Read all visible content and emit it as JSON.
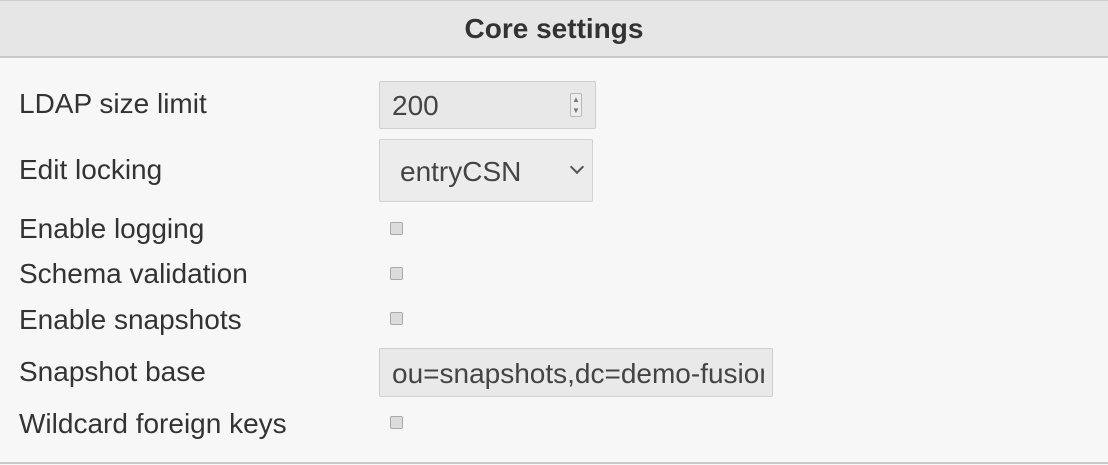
{
  "panel": {
    "title": "Core settings"
  },
  "fields": {
    "ldap_size_limit": {
      "label": "LDAP size limit",
      "value": "200"
    },
    "edit_locking": {
      "label": "Edit locking",
      "value": "entryCSN"
    },
    "enable_logging": {
      "label": "Enable logging",
      "checked": false
    },
    "schema_validation": {
      "label": "Schema validation",
      "checked": false
    },
    "enable_snapshots": {
      "label": "Enable snapshots",
      "checked": false
    },
    "snapshot_base": {
      "label": "Snapshot base",
      "value": "ou=snapshots,dc=demo-fusiondirectory,dc=org"
    },
    "wildcard_foreign_keys": {
      "label": "Wildcard foreign keys",
      "checked": false
    }
  }
}
